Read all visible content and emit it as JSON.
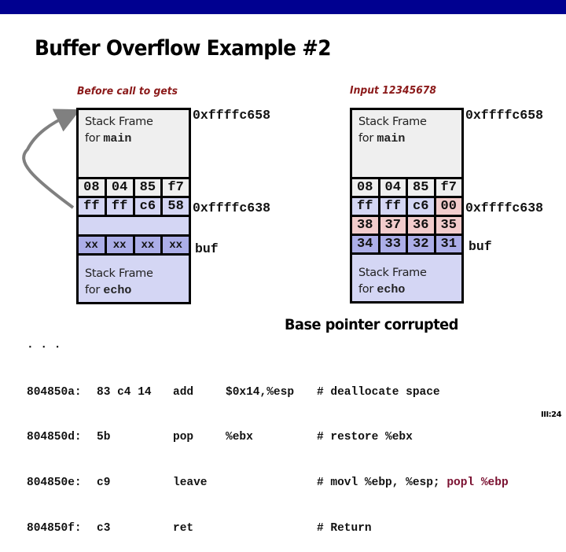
{
  "slide": {
    "title": "Buffer Overflow Example #2",
    "page_number": "III:24",
    "topbar_color": "#000090"
  },
  "left_panel": {
    "caption": "Before call to gets",
    "main_frame": {
      "label_line1": "Stack Frame",
      "label_for": "for ",
      "label_func": "main"
    },
    "main_frame_addr": "0xffffc658",
    "rows": [
      {
        "cells": [
          "08",
          "04",
          "85",
          "f7"
        ]
      },
      {
        "cells": [
          "ff",
          "ff",
          "c6",
          "58"
        ],
        "addr": "0xffffc638"
      },
      {
        "cells": []
      },
      {
        "cells": [
          "xx",
          "xx",
          "xx",
          "xx"
        ],
        "label": "buf"
      }
    ],
    "echo_frame": {
      "label_line1": "Stack Frame",
      "label_for": "for ",
      "label_func": "echo"
    }
  },
  "right_panel": {
    "caption": "Input 12345678",
    "main_frame": {
      "label_line1": "Stack Frame",
      "label_for": "for ",
      "label_func": "main"
    },
    "main_frame_addr": "0xffffc658",
    "rows": [
      {
        "cells": [
          "08",
          "04",
          "85",
          "f7"
        ]
      },
      {
        "cells": [
          "ff",
          "ff",
          "c6",
          "00"
        ],
        "addr": "0xffffc638"
      },
      {
        "cells": [
          "38",
          "37",
          "36",
          "35"
        ]
      },
      {
        "cells": [
          "34",
          "33",
          "32",
          "31"
        ],
        "label": "buf"
      }
    ],
    "echo_frame": {
      "label_line1": "Stack Frame",
      "label_for": "for ",
      "label_func": "echo"
    }
  },
  "annotation": "Base pointer corrupted",
  "disassembly": {
    "ellipsis": ". . .",
    "lines": [
      {
        "addr": "804850a:",
        "bytes": "83 c4 14",
        "op": "add",
        "args": "$0x14,%esp",
        "comment": "# deallocate space"
      },
      {
        "addr": "804850d:",
        "bytes": "5b",
        "op": "pop",
        "args": "%ebx",
        "comment": "# restore %ebx"
      },
      {
        "addr": "804850e:",
        "bytes": "c9",
        "op": "leave",
        "args": "",
        "comment": "# movl %ebp, %esp; ",
        "comment_highlight": "popl %ebp"
      },
      {
        "addr": "804850f:",
        "bytes": "c3",
        "op": "ret",
        "args": "",
        "comment": "# Return"
      }
    ]
  },
  "colors": {
    "caption": "#8b1a1a",
    "frame_gray": "#efefef",
    "frame_light_blue": "#d4d6f4",
    "buf_blue": "#acaee8",
    "overwritten_pink": "#f2cccc",
    "highlight_text": "#7a1030"
  }
}
